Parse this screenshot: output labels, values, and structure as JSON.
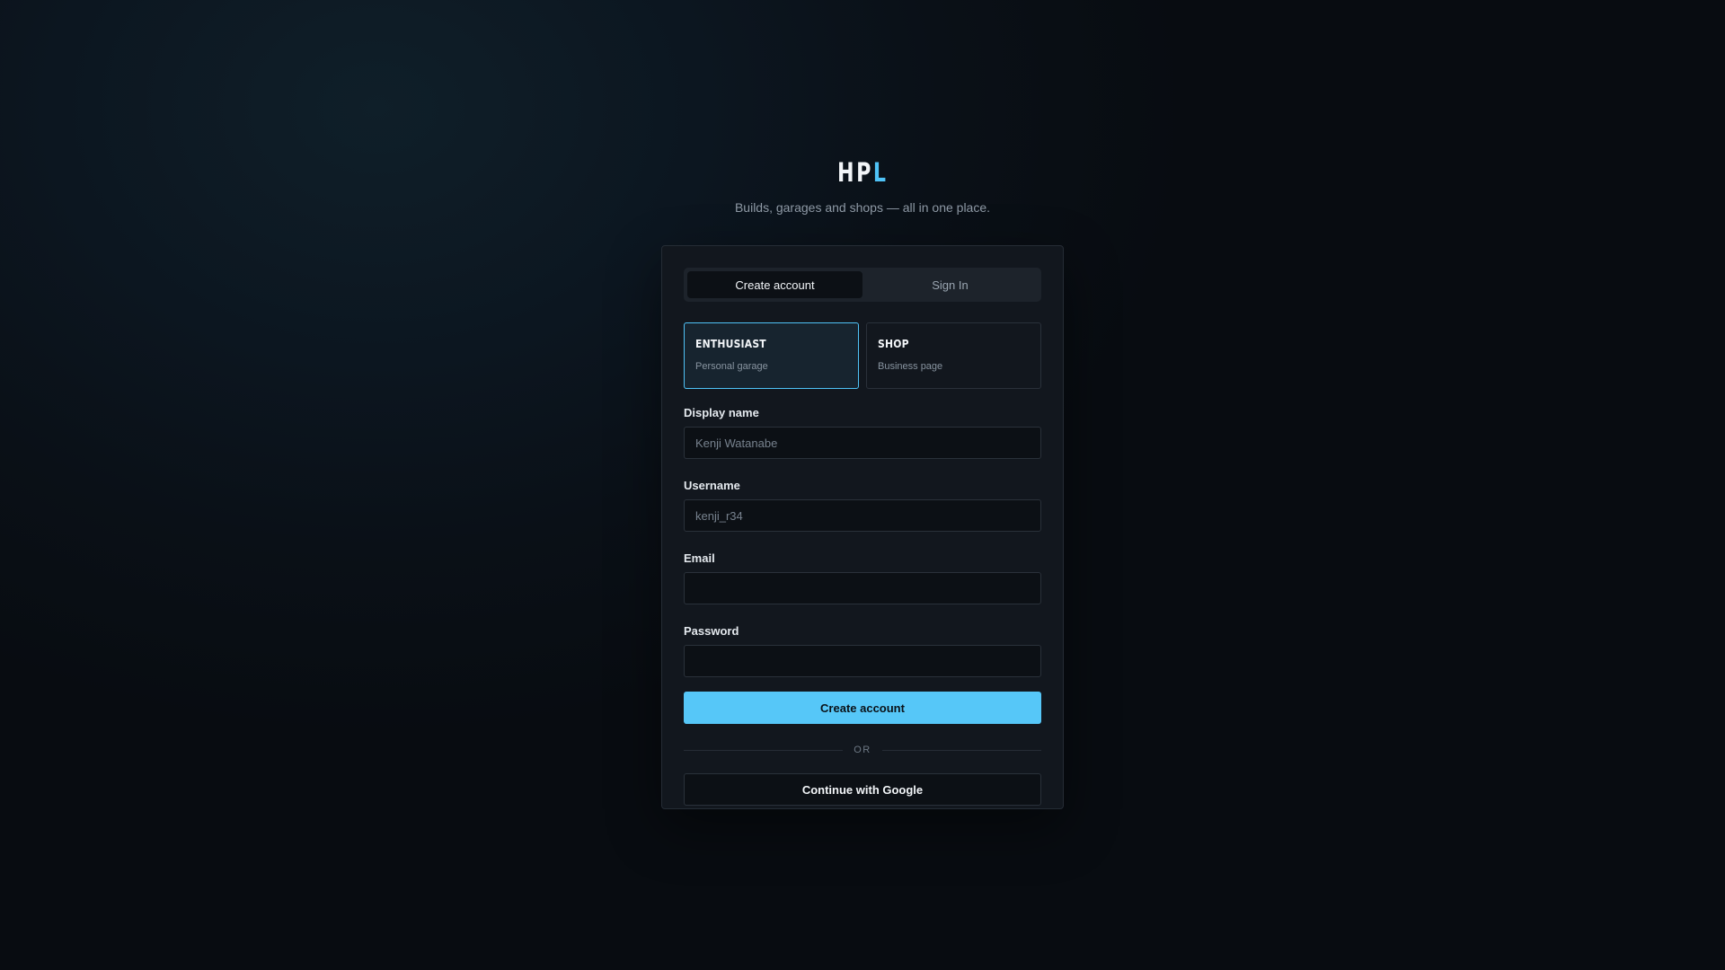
{
  "brand": {
    "logo_main": "HP",
    "logo_accent": "L",
    "tagline": "Builds, garages and shops — all in one place.",
    "accent_color": "#4fc3f7"
  },
  "tabs": [
    {
      "label": "Create account",
      "active": true
    },
    {
      "label": "Sign In",
      "active": false
    }
  ],
  "account_types": [
    {
      "title": "ENTHUSIAST",
      "subtitle": "Personal garage",
      "selected": true
    },
    {
      "title": "SHOP",
      "subtitle": "Business page",
      "selected": false
    }
  ],
  "form": {
    "display_name": {
      "label": "Display name",
      "value": "",
      "placeholder": "Kenji Watanabe"
    },
    "username": {
      "label": "Username",
      "value": "",
      "placeholder": "kenji_r34"
    },
    "email": {
      "label": "Email",
      "value": "",
      "placeholder": ""
    },
    "password": {
      "label": "Password",
      "value": "",
      "placeholder": ""
    }
  },
  "submit_label": "Create account",
  "divider_text": "OR",
  "google_label": "Continue with Google"
}
